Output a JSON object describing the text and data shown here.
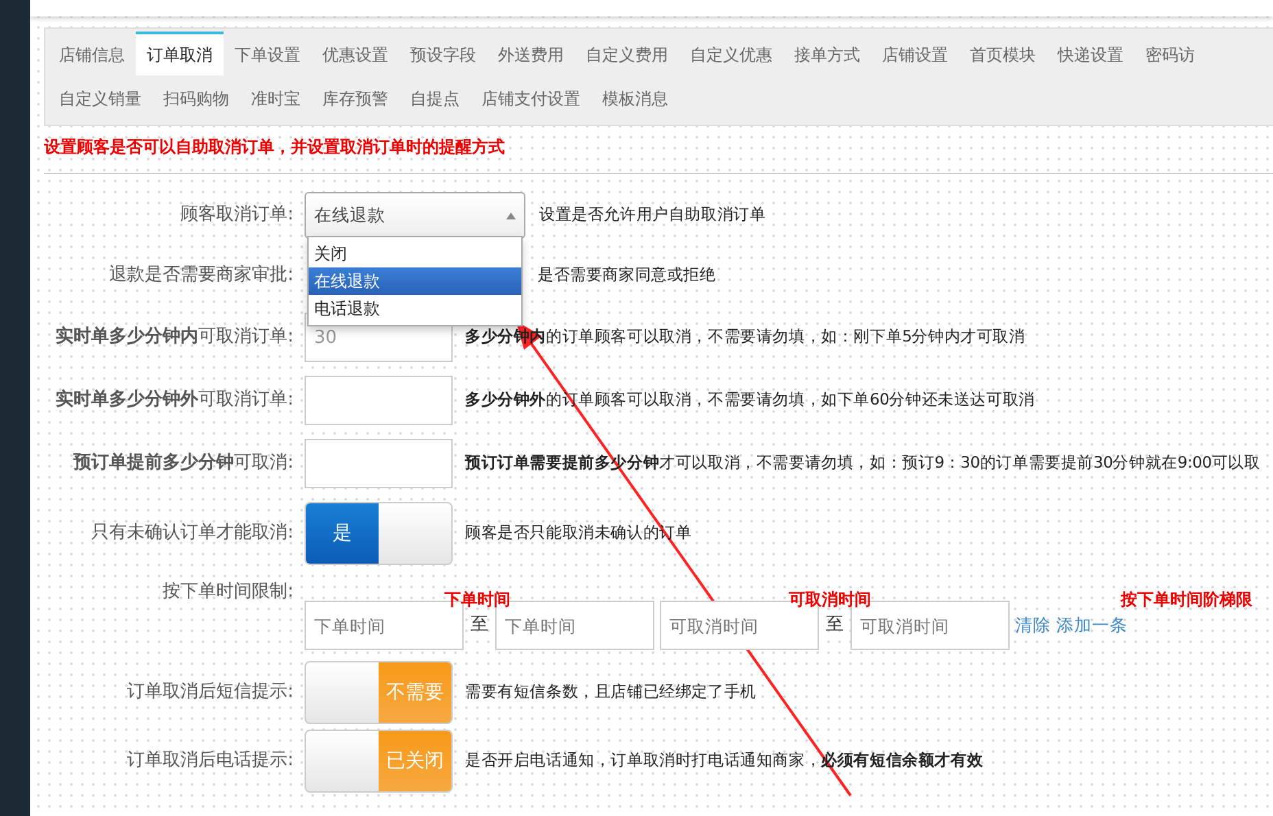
{
  "tabs": [
    [
      {
        "label": "店铺信息",
        "selected": false
      },
      {
        "label": "订单取消",
        "selected": true
      },
      {
        "label": "下单设置",
        "selected": false
      },
      {
        "label": "优惠设置",
        "selected": false
      },
      {
        "label": "预设字段",
        "selected": false
      },
      {
        "label": "外送费用",
        "selected": false
      },
      {
        "label": "自定义费用",
        "selected": false
      },
      {
        "label": "自定义优惠",
        "selected": false
      },
      {
        "label": "接单方式",
        "selected": false
      },
      {
        "label": "店铺设置",
        "selected": false
      },
      {
        "label": "首页模块",
        "selected": false
      },
      {
        "label": "快递设置",
        "selected": false
      },
      {
        "label": "密码访",
        "selected": false
      }
    ],
    [
      {
        "label": "自定义销量",
        "selected": false
      },
      {
        "label": "扫码购物",
        "selected": false
      },
      {
        "label": "准时宝",
        "selected": false
      },
      {
        "label": "库存预警",
        "selected": false
      },
      {
        "label": "自提点",
        "selected": false
      },
      {
        "label": "店铺支付设置",
        "selected": false
      },
      {
        "label": "模板消息",
        "selected": false
      }
    ]
  ],
  "notice": "设置顾客是否可以自助取消订单，并设置取消订单时的提醒方式",
  "rows": [
    {
      "kind": "select",
      "label": "顾客取消订单:",
      "value": "在线退款",
      "expanded": true,
      "options": [
        {
          "label": "关闭",
          "selected": false
        },
        {
          "label": "在线退款",
          "selected": true
        },
        {
          "label": "电话退款",
          "selected": false
        }
      ],
      "hint": "设置是否允许用户自助取消订单"
    },
    {
      "kind": "covered",
      "label": "退款是否需要商家审批:",
      "hint": "是否需要商家同意或拒绝"
    },
    {
      "kind": "input",
      "label": "**实时单多少分钟内**可取消订单:",
      "value": "30",
      "hint": "**多少分钟内**的订单顾客可以取消，不需要请勿填，如：刚下单5分钟内才可取消"
    },
    {
      "kind": "input",
      "label": "**实时单多少分钟外**可取消订单:",
      "hint": "**多少分钟外**的订单顾客可以取消，不需要请勿填，如下单60分钟还未送达可取消"
    },
    {
      "kind": "input",
      "label": "**预订单提前多少分钟**可取消:",
      "hint": "**预订订单需要提前多少分钟**才可以取消，不需要请勿填，如：预订9：30的订单需要提前30分钟就在9:00可以取"
    },
    {
      "kind": "toggle",
      "label": "只有未确认订单才能取消:",
      "on": true,
      "text": "是",
      "hint": "顾客是否只能取消未确认的订单"
    },
    {
      "kind": "time",
      "label": "按下单时间限制:",
      "headers": [
        "下单时间",
        "可取消时间",
        "按下单时间阶梯限"
      ],
      "ranges": [
        {
          "start": {
            "placeholder": "下单时间"
          },
          "sep": "至",
          "end": {
            "placeholder": "下单时间"
          }
        },
        {
          "start": {
            "placeholder": "可取消时间"
          },
          "sep": "至",
          "end": {
            "placeholder": "可取消时间"
          }
        }
      ],
      "links": [
        "清除",
        "添加一条"
      ]
    },
    {
      "kind": "toggle",
      "label": "订单取消后短信提示:",
      "on": false,
      "text": "不需要",
      "hint": "需要有短信条数，且店铺已经绑定了手机"
    },
    {
      "kind": "toggle",
      "label": "订单取消后电话提示:",
      "on": false,
      "text": "已关闭",
      "hint": "是否开启电话通知，订单取消时打电话通知商家，**必须有短信余额才有效**"
    }
  ]
}
